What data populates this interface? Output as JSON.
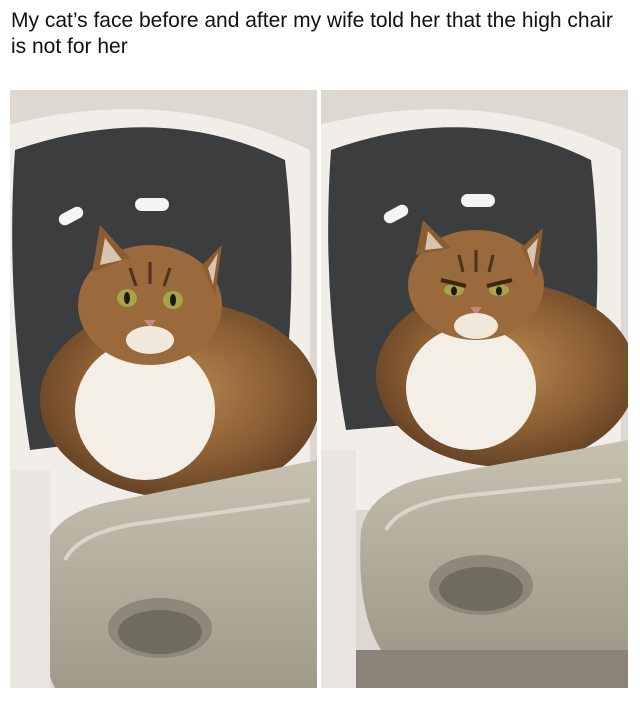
{
  "caption": "My cat’s face before and after my wife told her that the high chair is not for her",
  "photos": [
    {
      "subject": "cat-in-high-chair",
      "expression": "neutral"
    },
    {
      "subject": "cat-in-high-chair",
      "expression": "glaring"
    }
  ],
  "colors": {
    "background": "#ffffff",
    "wall": "#d9d4cf",
    "seat": "#3b3d3f",
    "chair_frame": "#f1eeea",
    "tray": "#b3ad9b",
    "fur_brown": "#9a6a3c",
    "fur_white": "#f3eee6",
    "eyes": "#a6a348"
  }
}
